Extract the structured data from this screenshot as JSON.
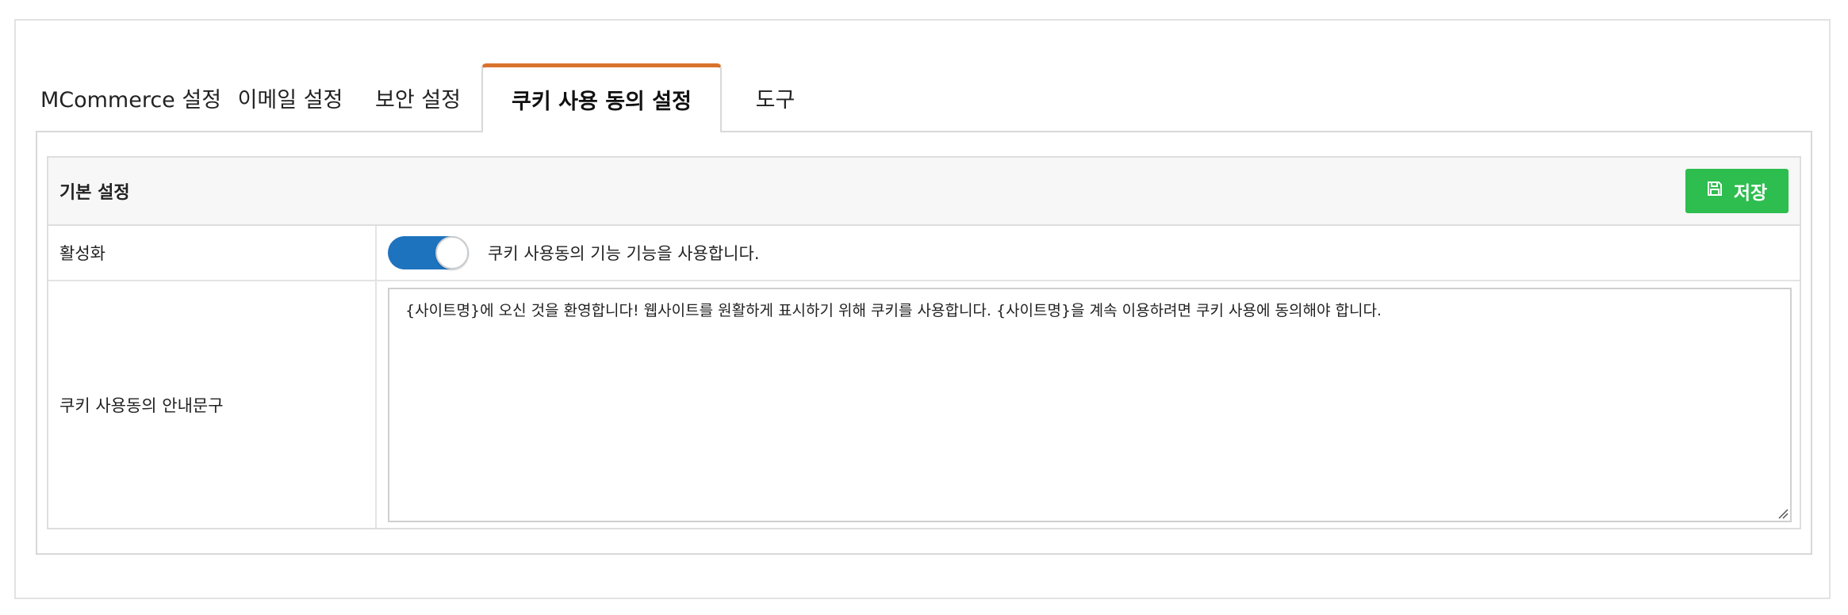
{
  "tabs": [
    {
      "label": "MCommerce 설정",
      "active": false
    },
    {
      "label": "이메일 설정",
      "active": false
    },
    {
      "label": "보안 설정",
      "active": false
    },
    {
      "label": "쿠키 사용 동의 설정",
      "active": true
    },
    {
      "label": "도구",
      "active": false
    }
  ],
  "section": {
    "title": "기본 설정",
    "save_label": "저장",
    "save_icon": "floppy-disk-icon"
  },
  "rows": {
    "activate": {
      "label": "활성화",
      "toggle_on": true,
      "description": "쿠키 사용동의 기능 기능을 사용합니다."
    },
    "message": {
      "label": "쿠키 사용동의 안내문구",
      "value": "{사이트명}에 오신 것을 환영합니다! 웹사이트를 원활하게 표시하기 위해 쿠키를 사용합니다. {사이트명}을 계속 이용하려면 쿠키 사용에 동의해야 합니다."
    }
  },
  "colors": {
    "active_tab_accent": "#d9722d",
    "save_button": "#2ebd4f",
    "toggle_on": "#1e73be"
  }
}
